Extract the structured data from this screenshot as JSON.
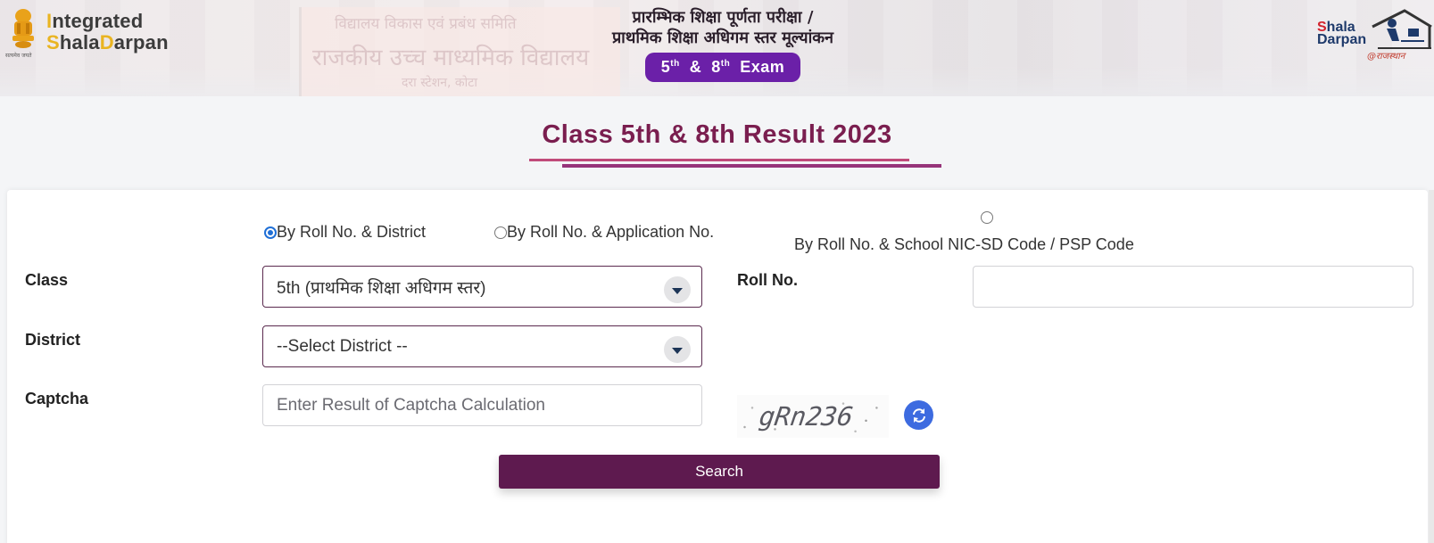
{
  "header": {
    "logo_left": {
      "line1_highlight": "I",
      "line1_rest": "ntegrated",
      "line2_s": "S",
      "line2_hala": "hala",
      "line2_d": "D",
      "line2_arpan": "arpan",
      "emblem_caption": "सत्यमेव जयते"
    },
    "hindi_title_line1": "प्रारम्भिक शिक्षा पूर्णता परीक्षा /",
    "hindi_title_line2": "प्राथमिक शिक्षा अधिगम स्तर मूल्यांकन",
    "exam_badge": {
      "num1": "5",
      "sup1": "th",
      "amp": "&",
      "num2": "8",
      "sup2": "th",
      "word": "Exam"
    },
    "logo_right": {
      "s": "S",
      "hala": "hala",
      "darpan": "Darpan",
      "tag": "@राजस्थान"
    },
    "background_text": {
      "line1": "विद्यालय विकास एवं प्रबंध समिति",
      "line2": "राजकीय उच्च माध्यमिक विद्यालय",
      "line3": "दरा स्टेशन, कोटा"
    }
  },
  "page": {
    "title": "Class 5th & 8th Result 2023"
  },
  "form": {
    "search_modes": [
      {
        "label": "By Roll No. & District",
        "checked": true
      },
      {
        "label": "By Roll No. & Application No.",
        "checked": false
      },
      {
        "label": "By Roll No. & School NIC-SD Code / PSP Code",
        "checked": false
      }
    ],
    "class": {
      "label": "Class",
      "selected": "5th (प्राथमिक शिक्षा अधिगम स्तर)"
    },
    "district": {
      "label": "District",
      "selected": "--Select District --"
    },
    "roll_no": {
      "label": "Roll No.",
      "value": "",
      "placeholder": ""
    },
    "captcha": {
      "label": "Captcha",
      "value": "",
      "placeholder": "Enter Result of Captcha Calculation",
      "image_text": "gRn236",
      "refresh_icon": "refresh-icon"
    },
    "search_button": "Search"
  },
  "colors": {
    "brand_maroon": "#5e1a4f",
    "title": "#7a1e4f",
    "exam_badge": "#6b20a8",
    "refresh": "#3d6be0",
    "radio_checked": "#1f6fd6",
    "logo_yellow": "#e9b421"
  }
}
